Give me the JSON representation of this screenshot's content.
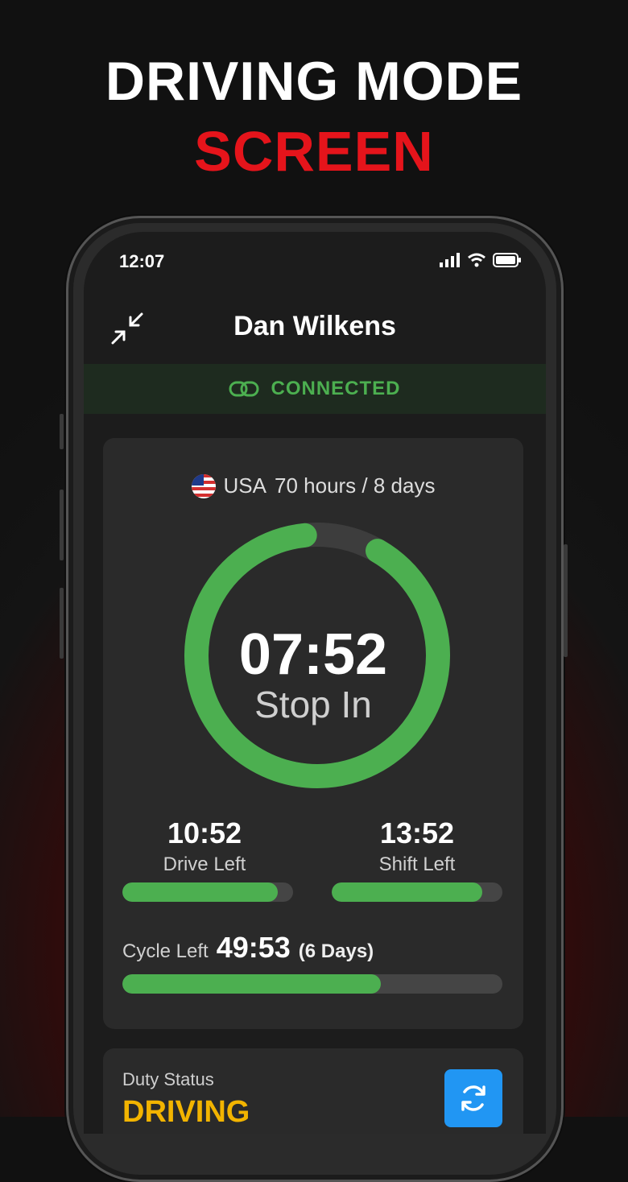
{
  "headline": {
    "line1": "DRIVING MODE",
    "line2": "SCREEN",
    "line2_color": "#e5141b"
  },
  "status_bar": {
    "time": "12:07"
  },
  "header": {
    "driver_name": "Dan Wilkens"
  },
  "connection": {
    "label": "CONNECTED"
  },
  "rules": {
    "country": "USA",
    "cycle": "70 hours / 8 days"
  },
  "timer": {
    "value": "07:52",
    "label": "Stop In",
    "progress": 0.9
  },
  "drive": {
    "value": "10:52",
    "label": "Drive Left",
    "progress": 0.91
  },
  "shift": {
    "value": "13:52",
    "label": "Shift Left",
    "progress": 0.88
  },
  "cycle_left": {
    "label": "Cycle Left",
    "value": "49:53",
    "days": "(6 Days)",
    "progress": 0.68
  },
  "duty": {
    "label": "Duty Status",
    "value": "DRIVING"
  },
  "colors": {
    "accent_green": "#4caf50",
    "duty_yellow": "#f2b400",
    "sync_blue": "#2196f3"
  }
}
